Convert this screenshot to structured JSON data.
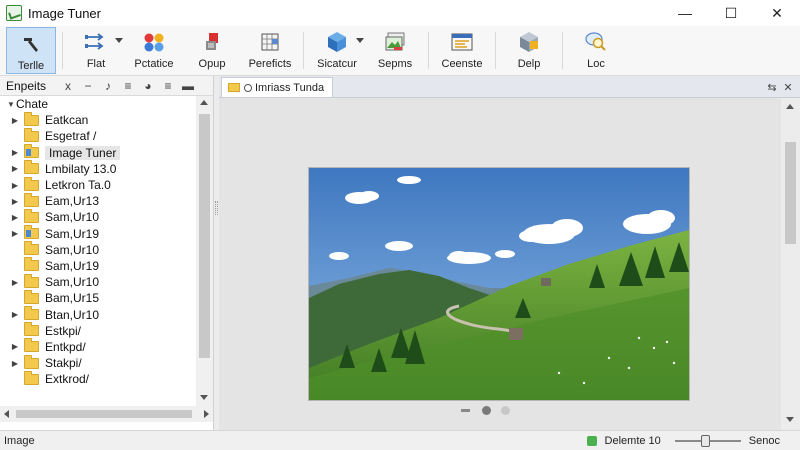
{
  "window": {
    "title": "Image Tuner",
    "minimize": "—",
    "maximize": "☐",
    "close": "✕"
  },
  "toolbar": {
    "tools": [
      {
        "label": "Terlle",
        "icon": "hammer-icon",
        "active": true
      },
      {
        "label": "Flat",
        "icon": "arrows-icon"
      },
      {
        "label": "Pctatice",
        "icon": "color-balls-icon"
      },
      {
        "label": "Opup",
        "icon": "paint-bucket-icon"
      },
      {
        "label": "Pereficts",
        "icon": "grid-doc-icon"
      },
      {
        "label": "Sicatcur",
        "icon": "cube-icon"
      },
      {
        "label": "Sepms",
        "icon": "image-stack-icon"
      },
      {
        "label": "Ceenste",
        "icon": "window-icon"
      },
      {
        "label": "Delp",
        "icon": "help-box-icon"
      },
      {
        "label": "Loc",
        "icon": "search-chat-icon"
      }
    ]
  },
  "left_panel": {
    "title": "Enpeits",
    "header_icons": [
      "x",
      "−",
      "♪",
      "≡",
      "◕",
      "≡",
      "▬"
    ],
    "root": "Chate",
    "items": [
      {
        "label": "Eatkcan",
        "expandable": true
      },
      {
        "label": "Esgetraf /",
        "expandable": false
      },
      {
        "label": "Image Tuner",
        "expandable": true,
        "selected": true,
        "special": true
      },
      {
        "label": "Lmbilaty 13.0",
        "expandable": true
      },
      {
        "label": "Letkron Ta.0",
        "expandable": true
      },
      {
        "label": "Eam,Ur13",
        "expandable": true
      },
      {
        "label": "Sam,Ur10",
        "expandable": true
      },
      {
        "label": "Sam,Ur19",
        "expandable": true,
        "special": true
      },
      {
        "label": "Sam,Ur10",
        "expandable": false
      },
      {
        "label": "Sam,Ur19",
        "expandable": false
      },
      {
        "label": "Sam,Ur10",
        "expandable": true
      },
      {
        "label": "Bam,Ur15",
        "expandable": false
      },
      {
        "label": "Btan,Ur10",
        "expandable": true
      },
      {
        "label": "Estkpi/",
        "expandable": false
      },
      {
        "label": "Entkpd/",
        "expandable": true
      },
      {
        "label": "Stakpi/",
        "expandable": true
      },
      {
        "label": "Extkrod/",
        "expandable": false
      }
    ]
  },
  "document": {
    "tab_label": "Imriass Tunda",
    "tab_actions": [
      "⇆",
      "✕"
    ]
  },
  "viewer": {
    "pages_total": 2,
    "current_page": 1,
    "sky_color": "#4c86c8",
    "hill_color": "#5a9a3a"
  },
  "statusbar": {
    "left": "Image",
    "zoom_label": "Delemte 10",
    "zoom_value": 0.48,
    "right": "Senoc"
  }
}
